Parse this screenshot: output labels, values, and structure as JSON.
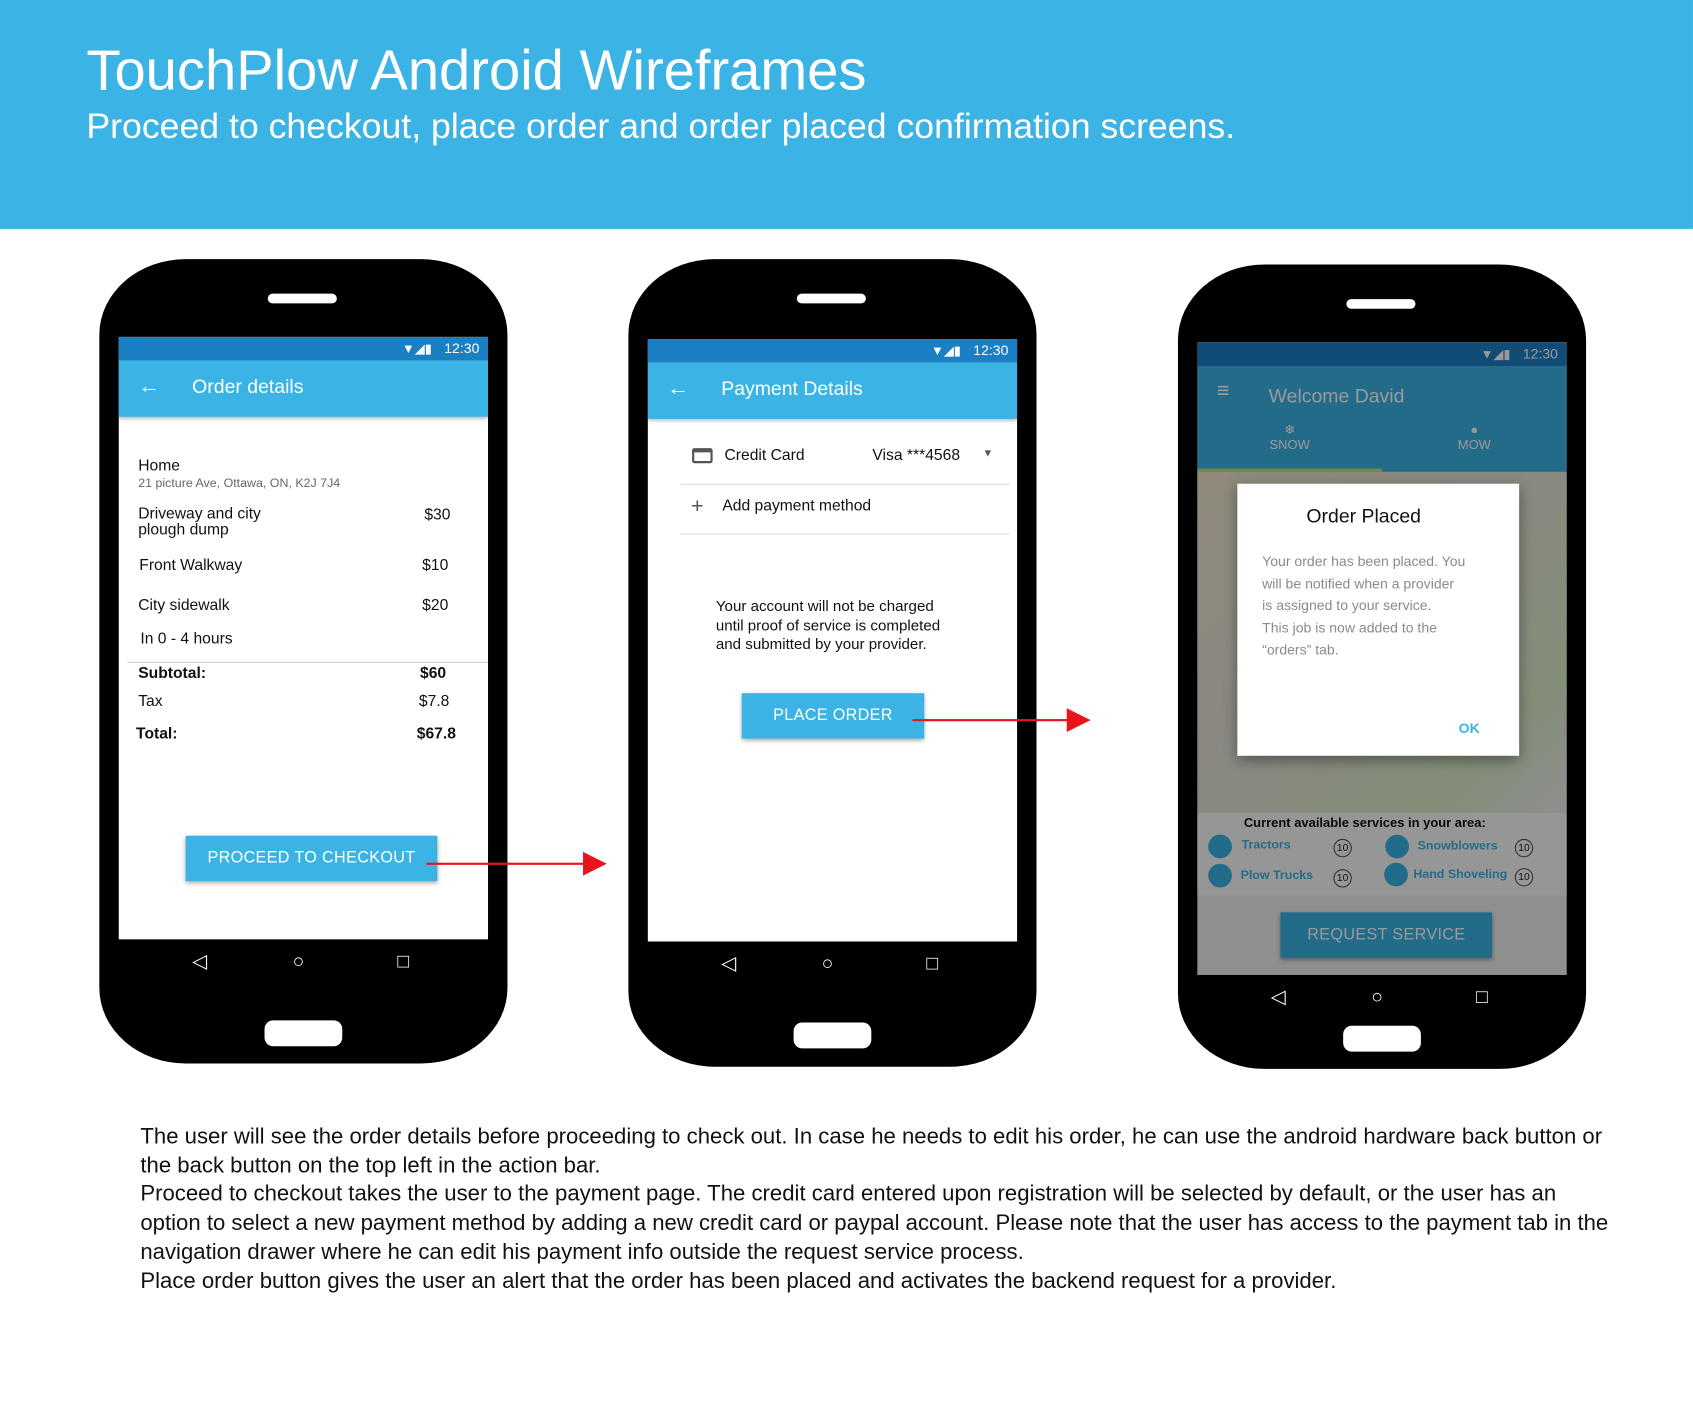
{
  "header": {
    "title": "TouchPlow Android Wireframes",
    "subtitle": "Proceed to checkout, place order and order placed confirmation screens."
  },
  "status_time": "12:30",
  "screen1": {
    "title": "Order details",
    "address_label": "Home",
    "address": "21 picture Ave, Ottawa, ON, K2J 7J4",
    "items": [
      {
        "name_line1": "Driveway and city",
        "name_line2": "plough dump",
        "price": "$30"
      },
      {
        "name": "Front Walkway",
        "price": "$10"
      },
      {
        "name": "City sidewalk",
        "price": "$20"
      }
    ],
    "eta": "In 0 - 4 hours",
    "subtotal_label": "Subtotal:",
    "subtotal": "$60",
    "tax_label": "Tax",
    "tax": "$7.8",
    "total_label": "Total:",
    "total": "$67.8",
    "button": "PROCEED TO CHECKOUT"
  },
  "screen2": {
    "title": "Payment Details",
    "method_label": "Credit Card",
    "method_value": "Visa ***4568",
    "add_method": "Add payment method",
    "notice_1": "Your account will not be charged",
    "notice_2": "until proof of service is completed",
    "notice_3": "and submitted by your provider.",
    "button": "PLACE ORDER"
  },
  "screen3": {
    "title": "Welcome David",
    "tabs": [
      "SNOW",
      "MOW"
    ],
    "services_title": "Current available services in your area:",
    "services": [
      {
        "name": "Tractors",
        "count": "10"
      },
      {
        "name": "Snowblowers",
        "count": "10"
      },
      {
        "name": "Plow Trucks",
        "count": "10"
      },
      {
        "name": "Hand Shoveling",
        "count": "10"
      }
    ],
    "button": "REQUEST SERVICE",
    "dialog": {
      "title": "Order Placed",
      "body_lines": [
        "Your order has been placed. You",
        "will be notified when a provider",
        "is assigned to your service.",
        "This job is now added to the",
        "“orders” tab."
      ],
      "ok": "OK"
    }
  },
  "caption": [
    "The user will see the order details before proceeding to check out. In case he needs to edit his order, he can use the android hardware back button or the back button on the top left in the action bar.",
    "Proceed to checkout takes the user to the payment page. The credit card entered upon registration will be selected by default, or the user has an option to select a new payment method by adding a new credit card or paypal account. Please note that the user has access to the payment tab in the navigation drawer where he can edit his payment info outside the request service process.",
    "Place order button gives the user an alert that the order has been placed and activates the backend request for a provider."
  ],
  "colors": {
    "accent": "#3bb4e5",
    "status_bar": "#1b7fc4",
    "arrow": "#e8141b"
  }
}
